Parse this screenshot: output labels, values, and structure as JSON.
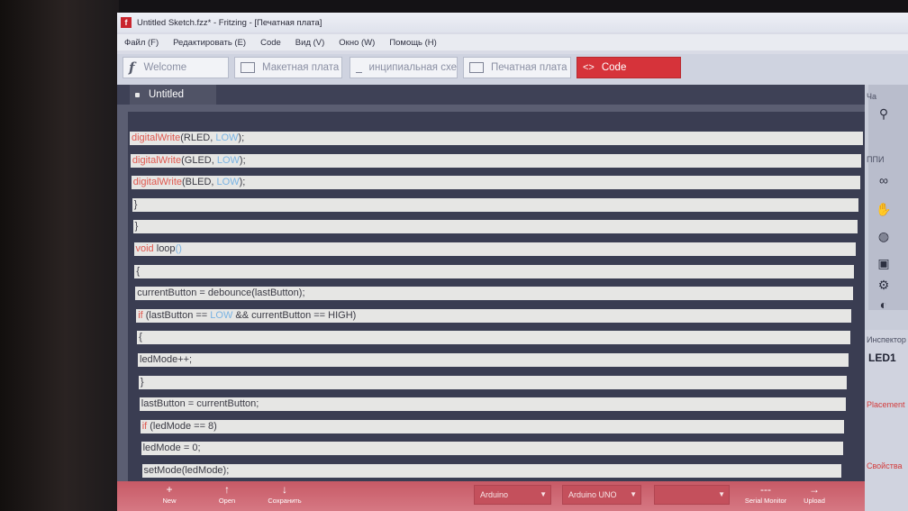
{
  "window": {
    "title": "Untitled Sketch.fzz* - Fritzing - [Печатная плата]"
  },
  "menu": [
    "Файл (F)",
    "Редактировать (E)",
    "Code",
    "Вид (V)",
    "Окно (W)",
    "Помощь (H)"
  ],
  "tabs": [
    {
      "label": "Welcome"
    },
    {
      "label": "Макетная плата"
    },
    {
      "label": "инципиальная схе"
    },
    {
      "label": "Печатная плата"
    },
    {
      "label": "Code",
      "active": true
    }
  ],
  "editor": {
    "doc_tab": "Untitled",
    "lines": [
      [
        "digitalWrite",
        "(RLED, ",
        "LOW",
        ");"
      ],
      [
        "digitalWrite",
        "(GLED, ",
        "LOW",
        ");"
      ],
      [
        "digitalWrite",
        "(BLED, ",
        "LOW",
        ");"
      ],
      [
        "",
        "}",
        "",
        ""
      ],
      [
        "",
        "}",
        "",
        ""
      ],
      [
        "void",
        " loop",
        "()",
        ""
      ],
      [
        "",
        "{",
        "",
        ""
      ],
      [
        "",
        "currentButton = debounce(lastButton);",
        "",
        ""
      ],
      [
        "if",
        " (lastButton == ",
        "LOW",
        " && currentButton == HIGH)"
      ],
      [
        "",
        "{",
        "",
        ""
      ],
      [
        "",
        "ledMode++;",
        "",
        ""
      ],
      [
        "",
        "}",
        "",
        ""
      ],
      [
        "",
        "lastButton = currentButton;",
        "",
        ""
      ],
      [
        "if",
        " (ledMode == 8)",
        "",
        ""
      ],
      [
        "",
        "ledMode = 0;",
        "",
        ""
      ],
      [
        "",
        "setMode(ledMode);",
        "",
        ""
      ],
      [
        "",
        "}",
        "",
        ""
      ]
    ]
  },
  "right_panel": {
    "label_top": "Ча",
    "label_mid": "ППИ",
    "inspector_header": "Инспектор",
    "inspector_title": "LED1",
    "placement_header": "Placement",
    "properties_header": "Свойства"
  },
  "bottom": {
    "buttons": [
      "New",
      "Open",
      "Сохранить",
      "Serial Monitor",
      "Upload"
    ],
    "board_language": "Arduino",
    "board_type": "Arduino UNO",
    "port": ""
  },
  "colors": {
    "active_tab": "#d6333a",
    "bottom_bar": "#c75a66",
    "keyword": "#e0584f",
    "constant": "#79b3e3"
  }
}
